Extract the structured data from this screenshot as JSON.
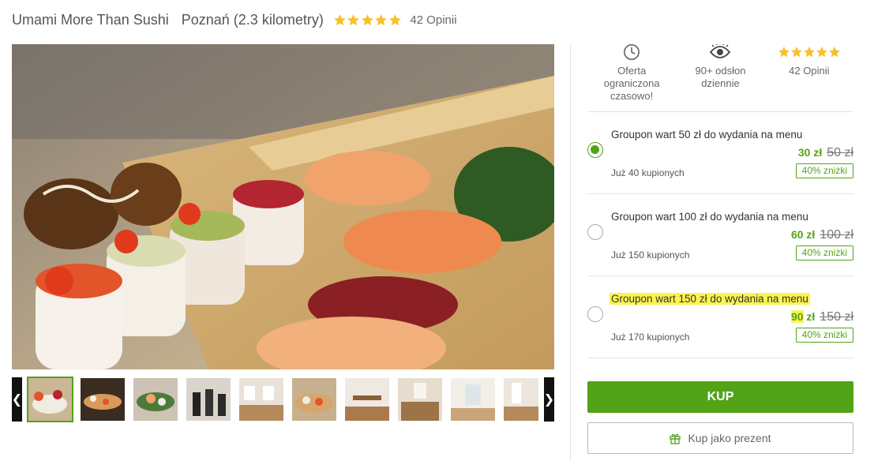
{
  "header": {
    "title": "Umami More Than Sushi",
    "location": "Poznań (2.3 kilometry)",
    "rating": 5,
    "reviews": "42 Opinii"
  },
  "gallery": {
    "thumbnail_count": 11,
    "active_index": 0
  },
  "features": [
    {
      "icon": "clock-icon",
      "text": "Oferta ograniczona czasowo!"
    },
    {
      "icon": "eye-icon",
      "text": "90+ odsłon dziennie"
    },
    {
      "icon": "stars-icon",
      "text": "42 Opinii"
    }
  ],
  "options": [
    {
      "title": "Groupon wart 50 zł do wydania na menu",
      "price_num": "30",
      "price_unit": "zł",
      "old_price": "50 zł",
      "sold": "Już 40 kupionych",
      "discount": "40% zniżki",
      "selected": true
    },
    {
      "title": "Groupon wart 100 zł do wydania na menu",
      "price_num": "60",
      "price_unit": "zł",
      "old_price": "100 zł",
      "sold": "Już 150 kupionych",
      "discount": "40% zniżki",
      "selected": false
    },
    {
      "title": "Groupon wart 150 zł do wydania na menu",
      "price_num": "90",
      "price_unit": "zł",
      "old_price": "150 zł",
      "sold": "Już 170 kupionych",
      "discount": "40% zniżki",
      "selected": false
    }
  ],
  "actions": {
    "buy_label": "KUP",
    "gift_label": "Kup jako prezent"
  },
  "colors": {
    "accent": "#53a318",
    "star": "#f7c02c",
    "highlight": "#fbf44f"
  }
}
